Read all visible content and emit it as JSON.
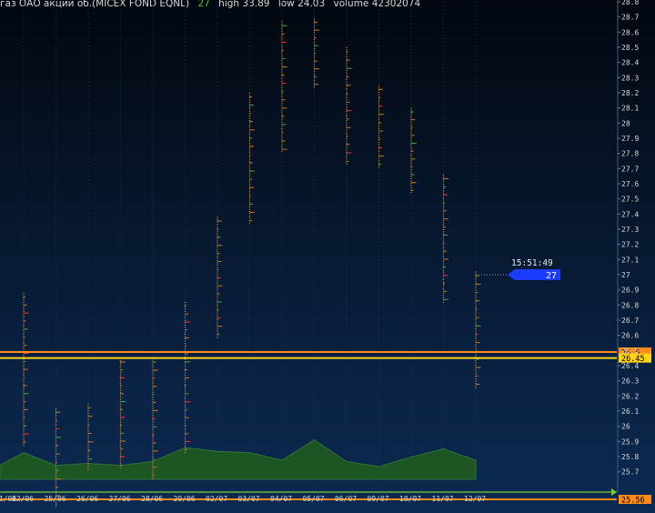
{
  "header": {
    "title": "газ ОАО акции об.(MICEX FOND EQNL)",
    "last": "27",
    "high_label": "high 33.89",
    "low_label": "low 24.03",
    "volume_label": "volume 42302074"
  },
  "cursor": {
    "time": "15:51:49",
    "price_label": "27"
  },
  "colors": {
    "accent_orange": "#ff8c1a",
    "accent_yellow": "#ffd21a",
    "cursor_blue": "#1a3cff",
    "volume_green": "#1f5a1f",
    "grid": "#1a3550"
  },
  "chart_data": {
    "type": "table",
    "description_type": "market profile / volume",
    "y_ticks": [
      "28.8",
      "28.7",
      "28.6",
      "28.5",
      "28.4",
      "28.3",
      "28.2",
      "28.1",
      "28",
      "27.9",
      "27.8",
      "27.7",
      "27.6",
      "27.5",
      "27.4",
      "27.3",
      "27.2",
      "27.1",
      "27",
      "26.9",
      "26.8",
      "26.7",
      "26.6",
      "26.5",
      "26.4",
      "26.3",
      "26.2",
      "26.1",
      "26",
      "25.9",
      "25.8",
      "25.7"
    ],
    "ylim": [
      25.65,
      28.8
    ],
    "x_ticks": [
      "22/06",
      "25/06",
      "26/06",
      "27/06",
      "28/06",
      "29/06",
      "02/07",
      "03/07",
      "04/07",
      "05/07",
      "06/07",
      "09/07",
      "10/07",
      "11/07",
      "12/07"
    ],
    "x_partial_left": "21/06",
    "price_levels": [
      {
        "label": "26.5",
        "value": 26.49,
        "color": "#ff8c1a"
      },
      {
        "label": "26.45",
        "value": 26.45,
        "color": "#ffd21a"
      },
      {
        "label": "25.56",
        "value": 25.56,
        "color": "#ff8c1a"
      }
    ],
    "days": [
      {
        "date": "22/06",
        "low": 25.87,
        "high": 26.88,
        "volume": 0.42
      },
      {
        "date": "25/06",
        "low": 25.46,
        "high": 26.12,
        "volume": 0.22
      },
      {
        "date": "26/06",
        "low": 25.7,
        "high": 26.15,
        "volume": 0.25
      },
      {
        "date": "27/06",
        "low": 25.72,
        "high": 26.45,
        "volume": 0.22
      },
      {
        "date": "28/06",
        "low": 25.65,
        "high": 26.45,
        "volume": 0.28
      },
      {
        "date": "29/06",
        "low": 25.82,
        "high": 26.82,
        "volume": 0.5
      },
      {
        "date": "02/07",
        "low": 26.58,
        "high": 27.38,
        "volume": 0.44
      },
      {
        "date": "03/07",
        "low": 27.33,
        "high": 28.2,
        "volume": 0.42
      },
      {
        "date": "04/07",
        "low": 27.8,
        "high": 28.67,
        "volume": 0.3
      },
      {
        "date": "05/07",
        "low": 28.23,
        "high": 28.69,
        "volume": 0.62
      },
      {
        "date": "06/07",
        "low": 27.72,
        "high": 28.5,
        "volume": 0.28
      },
      {
        "date": "09/07",
        "low": 27.7,
        "high": 28.25,
        "volume": 0.2
      },
      {
        "date": "10/07",
        "low": 27.53,
        "high": 28.1,
        "volume": 0.35
      },
      {
        "date": "11/07",
        "low": 26.81,
        "high": 27.66,
        "volume": 0.48
      },
      {
        "date": "12/07",
        "low": 26.25,
        "high": 27.02,
        "volume": 0.3
      }
    ]
  }
}
